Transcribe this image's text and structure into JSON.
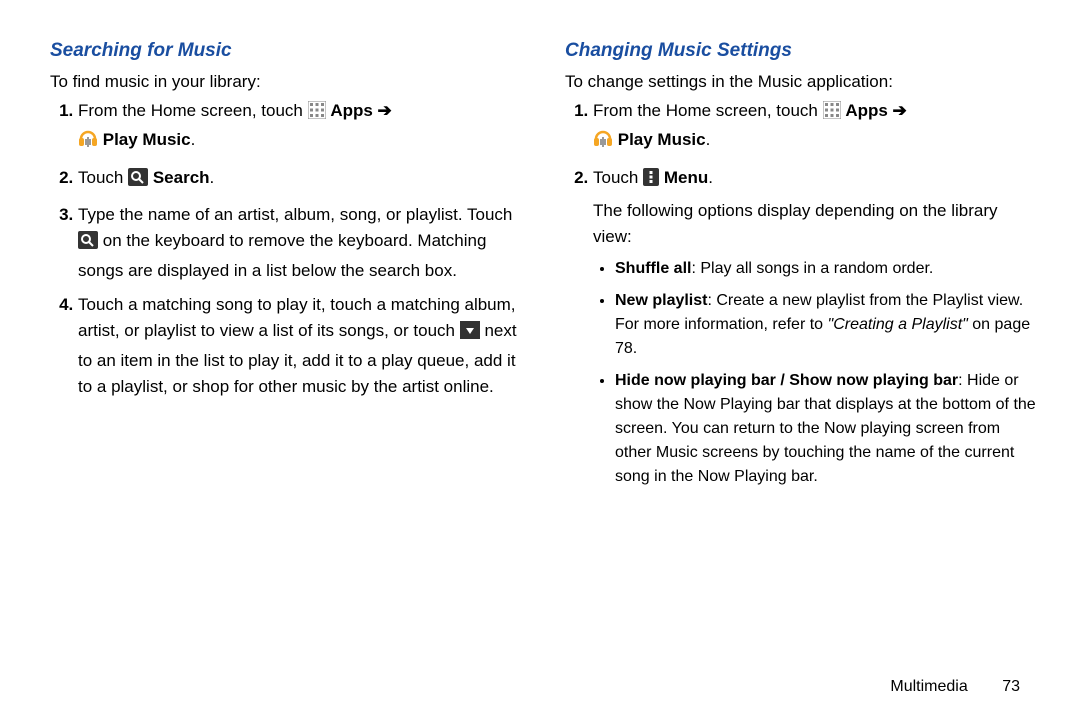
{
  "left": {
    "heading": "Searching for Music",
    "intro": "To find music in your library:",
    "step1_a": "From the Home screen, touch ",
    "apps": "Apps",
    "arrow": " ➔",
    "playmusic": "Play Music",
    "step2_a": "Touch ",
    "search": "Search",
    "step3_a": "Type the name of an artist, album, song, or playlist. Touch ",
    "step3_b": " on the keyboard to remove the keyboard. Matching songs are displayed in a list below the search box.",
    "step4_a": "Touch a matching song to play it, touch a matching album, artist, or playlist to view a list of its songs, or touch ",
    "step4_b": " next to an item in the list to play it, add it to a play queue, add it to a playlist, or shop for other music by the artist online."
  },
  "right": {
    "heading": "Changing Music Settings",
    "intro": "To change settings in the Music application:",
    "step1_a": "From the Home screen, touch ",
    "apps": "Apps",
    "arrow": " ➔",
    "playmusic": "Play Music",
    "step2_a": "Touch ",
    "menu": "Menu",
    "step2_b": "The following options display depending on the library view:",
    "b1_t": "Shuffle all",
    "b1_d": ": Play all songs in a random order.",
    "b2_t": "New playlist",
    "b2_d_a": ": Create a new playlist from the Playlist view. For more information, refer to ",
    "b2_ref": "\"Creating a Playlist\"",
    "b2_d_b": " on page 78.",
    "b3_t": "Hide now playing bar / Show now playing bar",
    "b3_d": ": Hide or show the Now Playing bar that displays at the bottom of the screen. You can return to the Now playing screen from other Music screens by touching the name of the current song in the Now Playing bar."
  },
  "footer": {
    "section": "Multimedia",
    "page": "73"
  }
}
